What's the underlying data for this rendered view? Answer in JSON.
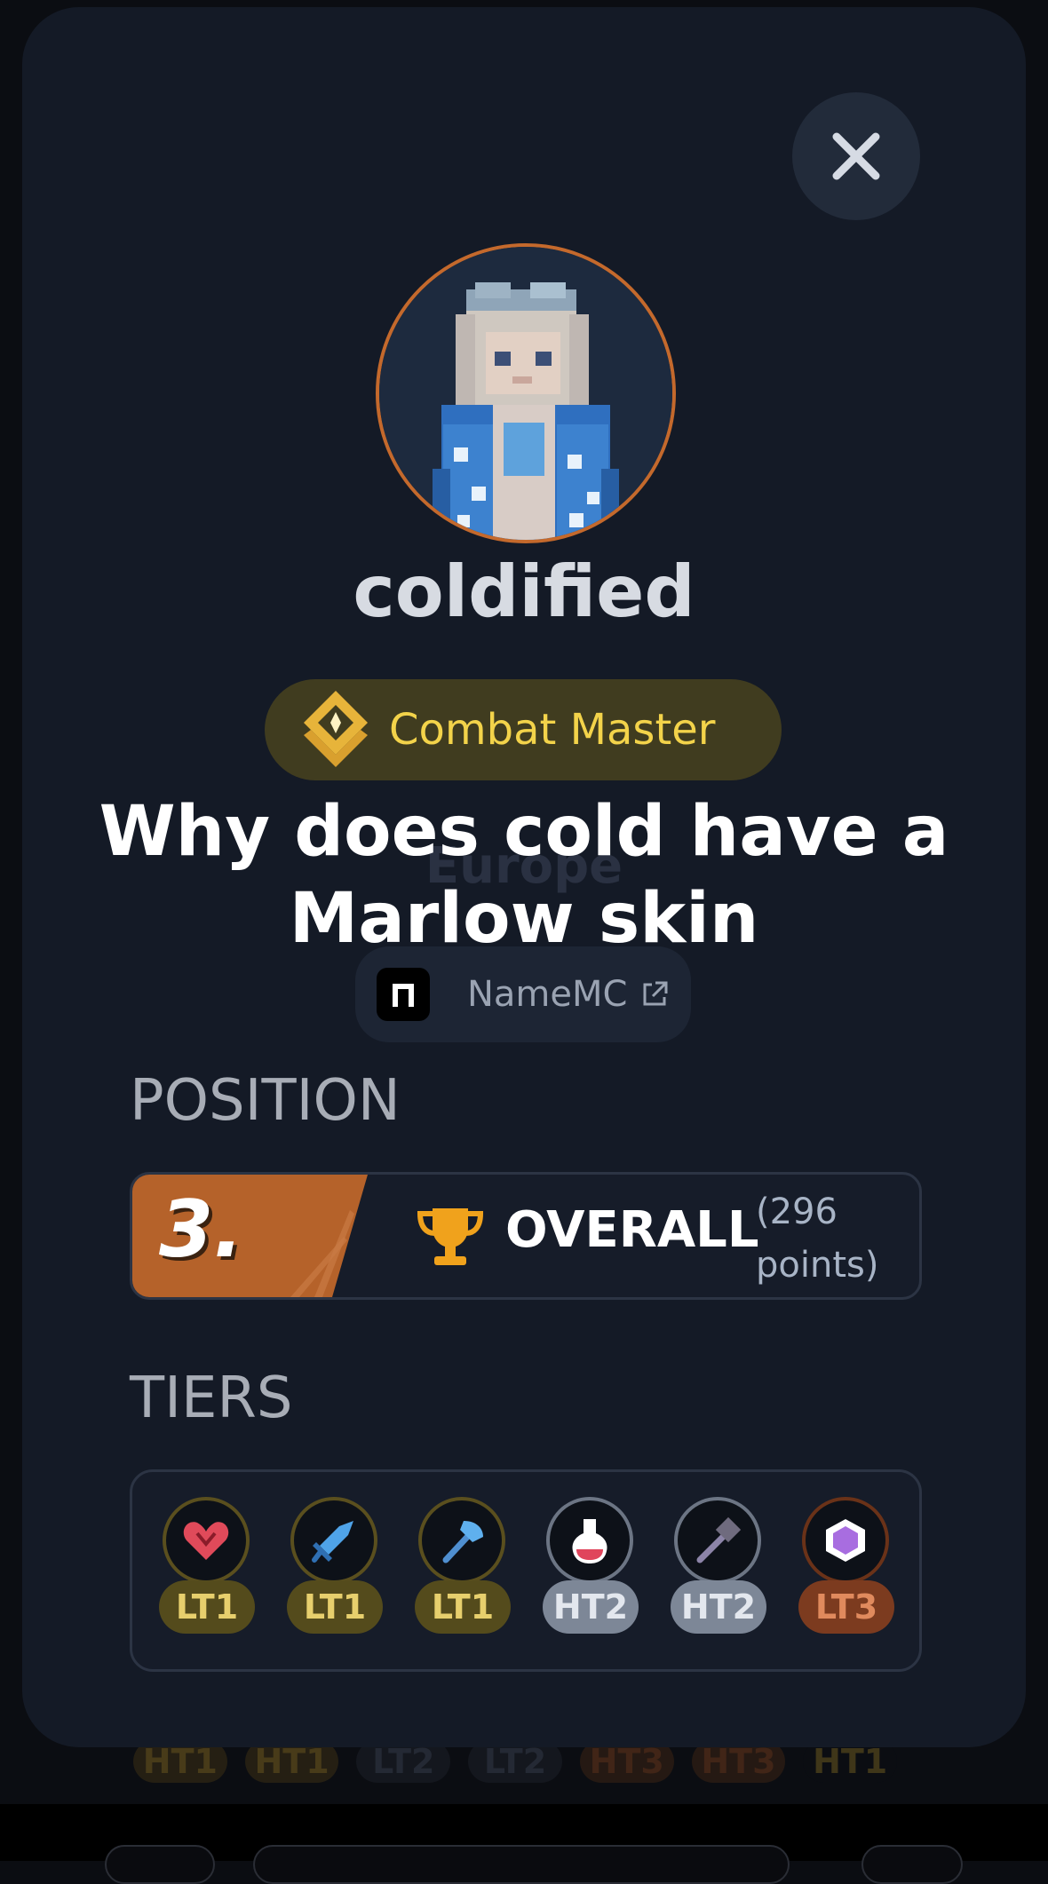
{
  "background": {
    "tiers": [
      {
        "label": "HT1",
        "color": "#3b2f14",
        "text": "#7a6220"
      },
      {
        "label": "HT1",
        "color": "#3b2f14",
        "text": "#7a6220"
      },
      {
        "label": "LT2",
        "color": "#1c2028",
        "text": "#3a4150"
      },
      {
        "label": "LT2",
        "color": "#1c2028",
        "text": "#3a4150"
      },
      {
        "label": "HT3",
        "color": "#3b2414",
        "text": "#6e3a1c"
      },
      {
        "label": "HT3",
        "color": "#3b2414",
        "text": "#6e3a1c"
      },
      {
        "label": "HT1",
        "color": "#0b0d12",
        "text": "#6a5820"
      }
    ]
  },
  "profile": {
    "close_icon": "close-icon",
    "avatar_icon": "minecraft-skin-avatar",
    "username": "coldified",
    "badge": {
      "label": "Combat Master",
      "icon": "combat-master-diamond-icon"
    },
    "region": "Europe",
    "caption_line1": "Why does cold have a",
    "caption_line2": "Marlow skin",
    "namemc": {
      "label": "NameMC",
      "icon": "namemc-logo-icon",
      "link_icon": "external-link-icon"
    }
  },
  "position": {
    "section_title": "POSITION",
    "rank": "3.",
    "category": "OVERALL",
    "points_line1": "(296",
    "points_line2": "points)",
    "icon": "trophy-icon",
    "rank_color": "#b5622a"
  },
  "tiers": {
    "section_title": "TIERS",
    "items": [
      {
        "label": "LT1",
        "icon": "heart-icon",
        "pill": "#544b1c",
        "text": "#e7cf6d",
        "ring": "#5a4f1e"
      },
      {
        "label": "LT1",
        "icon": "sword-icon",
        "pill": "#544b1c",
        "text": "#e7cf6d",
        "ring": "#5a4f1e"
      },
      {
        "label": "LT1",
        "icon": "axe-icon",
        "pill": "#544b1c",
        "text": "#e7cf6d",
        "ring": "#5a4f1e"
      },
      {
        "label": "HT2",
        "icon": "potion-icon",
        "pill": "#7d8797",
        "text": "#e3e7ee",
        "ring": "#6c7584"
      },
      {
        "label": "HT2",
        "icon": "mace-icon",
        "pill": "#7d8797",
        "text": "#e3e7ee",
        "ring": "#6c7584"
      },
      {
        "label": "LT3",
        "icon": "crystal-icon",
        "pill": "#7c3b1f",
        "text": "#e08a5d",
        "ring": "#6a3218"
      }
    ]
  }
}
